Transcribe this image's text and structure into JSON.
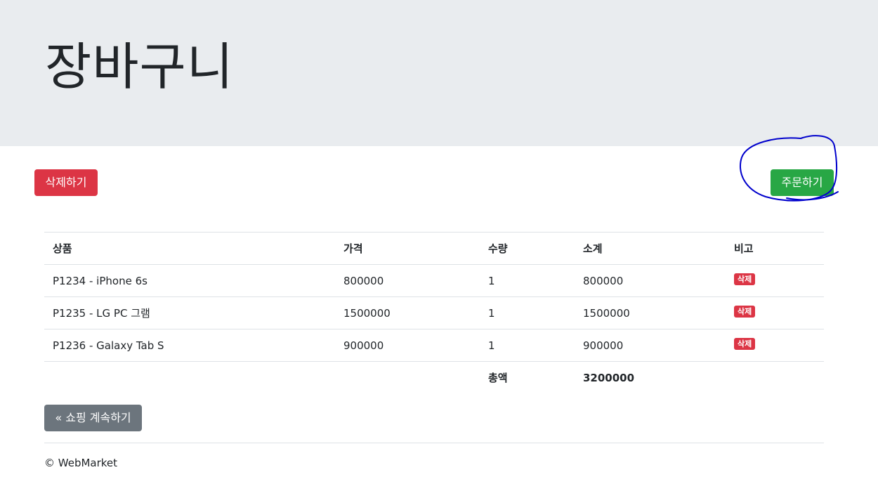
{
  "header": {
    "title": "장바구니"
  },
  "actions": {
    "delete_all_label": "삭제하기",
    "order_label": "주문하기"
  },
  "table": {
    "columns": [
      "상품",
      "가격",
      "수량",
      "소계",
      "비고"
    ],
    "rows": [
      {
        "product": "P1234 - iPhone 6s",
        "price": "800000",
        "qty": "1",
        "subtotal": "800000",
        "remove_label": "삭제"
      },
      {
        "product": "P1235 - LG PC 그램",
        "price": "1500000",
        "qty": "1",
        "subtotal": "1500000",
        "remove_label": "삭제"
      },
      {
        "product": "P1236 - Galaxy Tab S",
        "price": "900000",
        "qty": "1",
        "subtotal": "900000",
        "remove_label": "삭제"
      }
    ],
    "total_label": "총액",
    "total_value": "3200000"
  },
  "continue_label": "« 쇼핑 계속하기",
  "footer": {
    "text": "© WebMarket"
  },
  "colors": {
    "danger": "#dc3545",
    "success": "#28a745",
    "secondary": "#6c757d",
    "jumbotron": "#e9ecef",
    "annotation": "#0000cc"
  }
}
